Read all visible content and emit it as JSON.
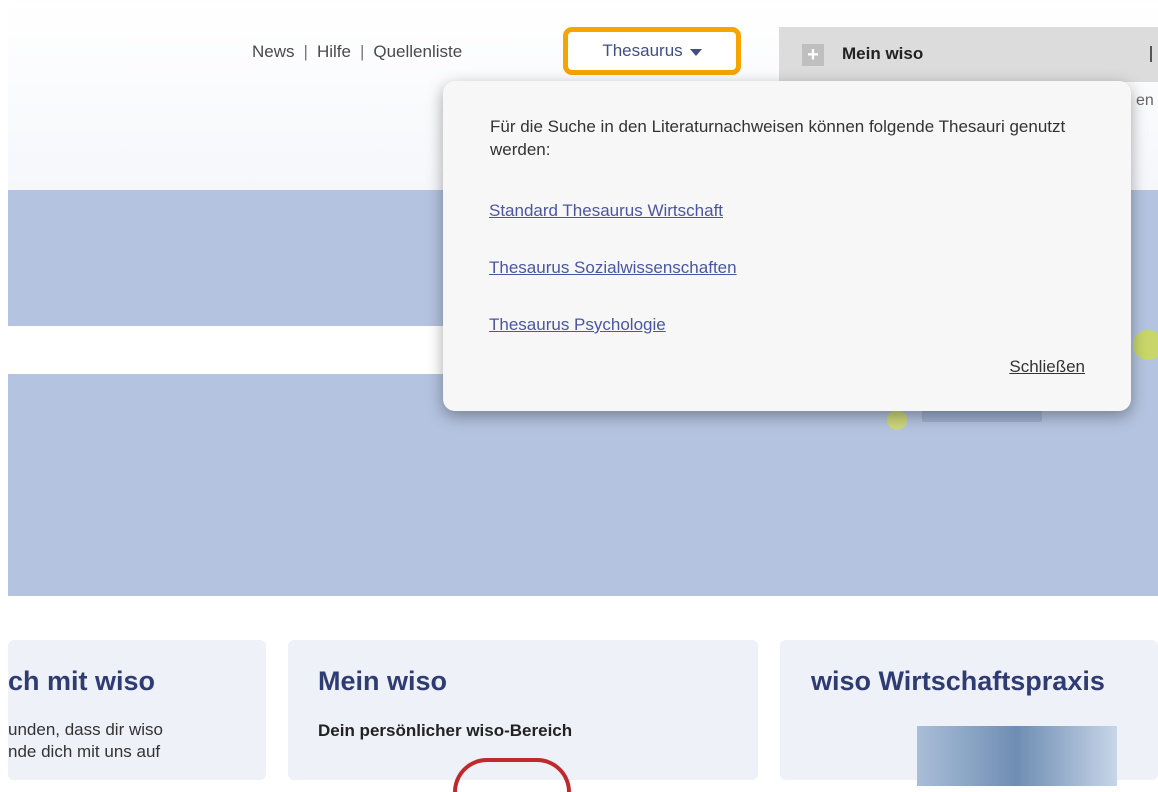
{
  "nav": {
    "news": "News",
    "hilfe": "Hilfe",
    "quellenliste": "Quellenliste",
    "thesaurus": "Thesaurus",
    "separator": "|"
  },
  "account": {
    "label": "Mein wiso",
    "plus": "+",
    "behind_text": "en"
  },
  "thesaurus_menu": {
    "intro": "Für die Suche in den Literaturnachweisen können folgende Thesauri genutzt werden:",
    "options": [
      "Standard Thesaurus Wirtschaft",
      "Thesaurus Sozialwissenschaften",
      "Thesaurus Psychologie"
    ],
    "close": "Schließen"
  },
  "cards": [
    {
      "title": "ch mit wiso",
      "lines": [
        "unden, dass dir wiso",
        "nde dich mit uns auf"
      ]
    },
    {
      "title": "Mein wiso",
      "subtitle": "Dein persönlicher wiso-Bereich"
    },
    {
      "title": "wiso Wirtschaftspraxis"
    }
  ],
  "colors": {
    "accent_highlight": "#f5a400",
    "link": "#4a56a3",
    "heading": "#2f3c73",
    "hero_bg": "#b4c3e0"
  },
  "icons": [
    "plus-icon",
    "caret-down-icon"
  ]
}
